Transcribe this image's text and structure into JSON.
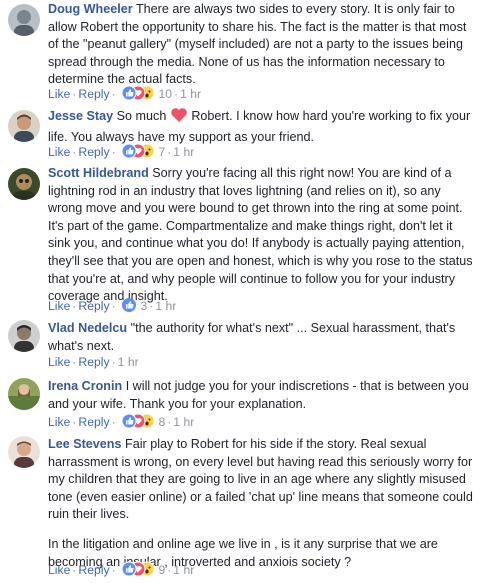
{
  "comments": [
    {
      "name": "Doug Wheeler",
      "text": "There are always two sides to every story. It is only fair to allow Robert the opportunity to share his. The fact is the matter is that most of the \"peanut gallery\" (myself included) are not a party to the issues being spread through the media. None of us has the information necessary to determine the actual facts.",
      "like": "Like",
      "reply": "Reply",
      "reactions": [
        "like",
        "love",
        "wow"
      ],
      "count": "10",
      "time": "1 hr",
      "avatar_color": "#7a8590"
    },
    {
      "name": "Jesse Stay",
      "text_before": "So much",
      "emoji": "heart-icon",
      "text": "Robert. I know how hard you're working to fix your life. You always have my support as your friend.",
      "like": "Like",
      "reply": "Reply",
      "reactions": [
        "like",
        "love",
        "wow"
      ],
      "count": "7",
      "time": "1 hr",
      "avatar_color": "#8a6a50"
    },
    {
      "name": "Scott Hildebrand",
      "text": "Sorry you're facing all this right now! You are kind of a lightning rod in an industry that loves lightning (and relies on it), so any wrong move and you were bound to get thrown into the ring at some point. It's part of the game. Compartmentalize and make things right, don't let it sink you, and continue what you do! If anybody is actually paying attention, they'll see that you are open and honest, which is why you rose to the status that you're at, and why people will continue to follow you for your industry coverage and insight.",
      "like": "Like",
      "reply": "Reply",
      "reactions": [
        "like"
      ],
      "count": "3",
      "time": "1 hr",
      "avatar_color": "#4a5a3a"
    },
    {
      "name": "Vlad Nedelcu",
      "text": "\"the authority for what's next\" ... Sexual harassment, that's what's next.",
      "like": "Like",
      "reply": "Reply",
      "time": "1 hr",
      "avatar_color": "#6a6a6a"
    },
    {
      "name": "Irena Cronin",
      "text": "I will not judge you for your indiscretions - that is between you and your wife. Thank you for your explanation.",
      "like": "Like",
      "reply": "Reply",
      "reactions": [
        "like",
        "love",
        "wow"
      ],
      "count": "8",
      "time": "1 hr",
      "avatar_color": "#9a8a5a"
    },
    {
      "name": "Lee Stevens",
      "text": "Fair play to Robert for his side if the story. Real sexual harrassment is wrong, on every level but having read this seriously worry for my children that they are going to live in an age where any slightly misused tone (even easier online) or a failed 'chat up' line means that someone could ruin their lives.",
      "text2": "In the litigation and online age we live in , is it any surprise that we are becoming an insular , introverted and anxiois society ?",
      "like": "Like",
      "reply": "Reply",
      "reactions": [
        "like",
        "love",
        "wow"
      ],
      "count": "9",
      "time": "1 hr",
      "avatar_color": "#c8b8a8"
    }
  ],
  "colors": {
    "name": "#365899",
    "link": "#4267b2",
    "meta": "#90949c",
    "text": "#1d2129",
    "like_reaction": "#5890ff",
    "love_reaction": "#f25268",
    "wow_reaction": "#fcd145"
  }
}
